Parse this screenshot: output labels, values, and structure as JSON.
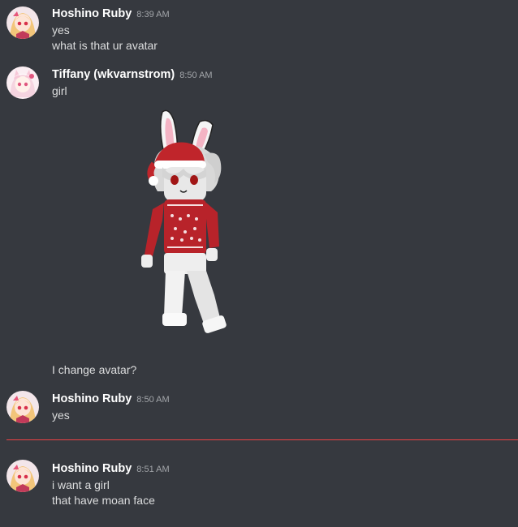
{
  "messages": [
    {
      "author": "Hoshino Ruby",
      "time": "8:39 AM",
      "lines": [
        "yes",
        "what is that ur avatar"
      ]
    },
    {
      "author": "Tiffany (wkvarnstrom)",
      "time": "8:50 AM",
      "lines": [
        "girl"
      ],
      "followup": "I change avatar?"
    },
    {
      "author": "Hoshino Ruby",
      "time": "8:50 AM",
      "lines": [
        "yes"
      ]
    },
    {
      "author": "Hoshino Ruby",
      "time": "8:51 AM",
      "lines": [
        "i want a girl",
        "that have moan face"
      ]
    }
  ],
  "colors": {
    "background": "#36393f",
    "username": "#ffffff",
    "message_text": "#dcddde",
    "timestamp": "#a3a6aa",
    "new_messages_divider": "#ed4245"
  }
}
